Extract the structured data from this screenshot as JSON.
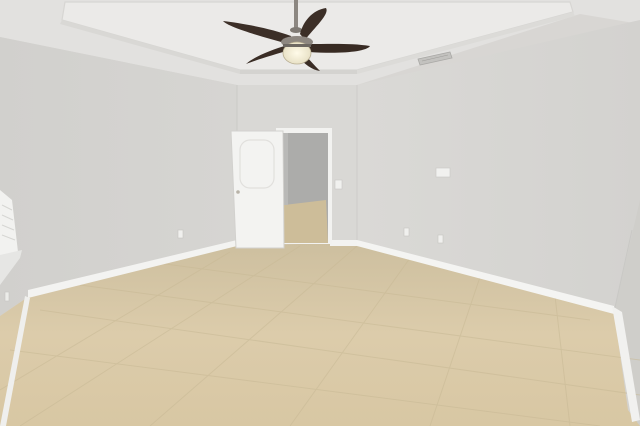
{
  "scene": {
    "subject": "empty-room",
    "colors": {
      "wall": "#d9d8d6",
      "wall_shadow": "#cfcecb",
      "ceiling": "#e4e3e1",
      "tray": "#ebeae8",
      "baseboard": "#f4f4f2",
      "floor_light": "#e2d6bd",
      "floor_dark": "#c9b690",
      "grout": "#cbbd9d",
      "door": "#f3f3f1",
      "hallway": "#aeaeac",
      "fan_blade": "#3c2f27",
      "fan_light": "#f6f1df",
      "fan_metal": "#8c8781"
    },
    "objects": [
      "ceiling-fan-icon",
      "air-vent-icon",
      "open-door-icon",
      "light-switch-icon",
      "electrical-outlet-icon",
      "window-icon"
    ]
  }
}
